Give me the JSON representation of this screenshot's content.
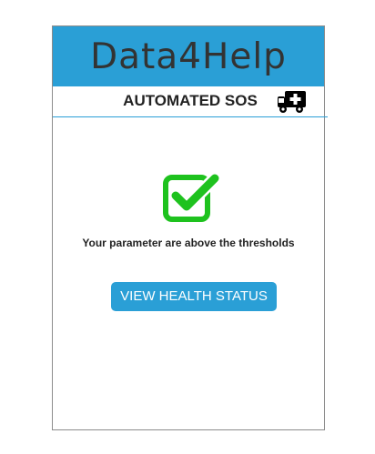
{
  "app": {
    "title": "Data4Help"
  },
  "header": {
    "section_title": "AUTOMATED SOS",
    "section_icon": "ambulance-icon"
  },
  "status": {
    "icon": "check-square-icon",
    "message": "Your parameter are above the thresholds"
  },
  "actions": {
    "view_health_label": "VIEW HEALTH STATUS"
  },
  "colors": {
    "accent": "#2a9fd6",
    "success": "#1ec21e",
    "frame_border": "#8c8c8c"
  }
}
